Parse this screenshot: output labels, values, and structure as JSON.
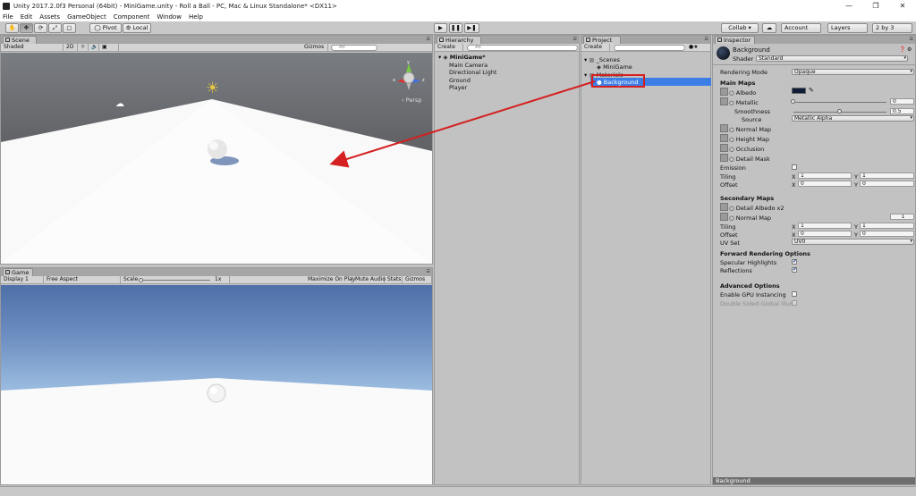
{
  "window": {
    "title": "Unity 2017.2.0f3 Personal (64bit) - MiniGame.unity - Roll a Ball - PC, Mac & Linux Standalone* <DX11>",
    "minimize": "—",
    "maximize": "❐",
    "close": "✕"
  },
  "menu": [
    "File",
    "Edit",
    "Assets",
    "GameObject",
    "Component",
    "Window",
    "Help"
  ],
  "toolbar": {
    "pivot": "Pivot",
    "local": "Local",
    "play": "▶",
    "pause": "❚❚",
    "step": "▶❚",
    "collab": "Collab ▾",
    "cloud": "☁",
    "account": "Account",
    "layers": "Layers",
    "layout": "2 by 3"
  },
  "scene": {
    "tab": "Scene",
    "shading": "Shaded",
    "mode2d": "2D",
    "gizmos": "Gizmos",
    "search": "All",
    "persp": "‹ Persp",
    "axis_labels": {
      "y": "y",
      "x": "x",
      "z": "z"
    }
  },
  "game": {
    "tab": "Game",
    "display": "Display 1",
    "aspect": "Free Aspect",
    "scale_label": "Scale",
    "scale_value": "1x",
    "maximize": "Maximize On Play",
    "mute": "Mute Audio",
    "stats": "Stats",
    "gizmos": "Gizmos"
  },
  "hierarchy": {
    "tab": "Hierarchy",
    "create": "Create",
    "search": "All",
    "scene": "MiniGame*",
    "items": [
      "Main Camera",
      "Directional Light",
      "Ground",
      "Player"
    ]
  },
  "project": {
    "tab": "Project",
    "create": "Create",
    "items": [
      {
        "label": "_Scenes",
        "type": "folder",
        "level": 0
      },
      {
        "label": "MiniGame",
        "type": "scene",
        "level": 1
      },
      {
        "label": "Materials",
        "type": "folder",
        "level": 0
      },
      {
        "label": "Background",
        "type": "material",
        "level": 1,
        "selected": true
      }
    ]
  },
  "inspector": {
    "tab": "Inspector",
    "name": "Background",
    "shader_label": "Shader",
    "shader": "Standard",
    "rendering_mode_label": "Rendering Mode",
    "rendering_mode": "Opaque",
    "main_maps": "Main Maps",
    "albedo": "Albedo",
    "albedo_color": "#0f1e36",
    "metallic": "Metallic",
    "metallic_value": "0",
    "metallic_fraction": 0.0,
    "smoothness": "Smoothness",
    "smoothness_value": "0.5",
    "smoothness_fraction": 0.5,
    "source_label": "Source",
    "source": "Metallic Alpha",
    "normal_map": "Normal Map",
    "height_map": "Height Map",
    "occlusion": "Occlusion",
    "detail_mask": "Detail Mask",
    "emission": "Emission",
    "tiling_label": "Tiling",
    "offset_label": "Offset",
    "tiling_x": "1",
    "tiling_y": "1",
    "offset_x": "0",
    "offset_y": "0",
    "axis_x": "X",
    "axis_y": "Y",
    "secondary_maps": "Secondary Maps",
    "detail_albedo": "Detail Albedo x2",
    "normal_map2": "Normal Map",
    "normal_map2_value": "1",
    "tiling2_x": "1",
    "tiling2_y": "1",
    "offset2_x": "0",
    "offset2_y": "0",
    "uv_set_label": "UV Set",
    "uv_set": "UV0",
    "forward_options": "Forward Rendering Options",
    "specular": "Specular Highlights",
    "specular_on": true,
    "reflections": "Reflections",
    "reflections_on": true,
    "advanced": "Advanced Options",
    "gpu_instancing": "Enable GPU Instancing",
    "double_sided": "Double Sided Global Illum",
    "preview_name": "Background"
  },
  "colors": {
    "selection": "#3d7ee6",
    "annotation": "#d42020",
    "sky_top": "#4e70a8"
  }
}
